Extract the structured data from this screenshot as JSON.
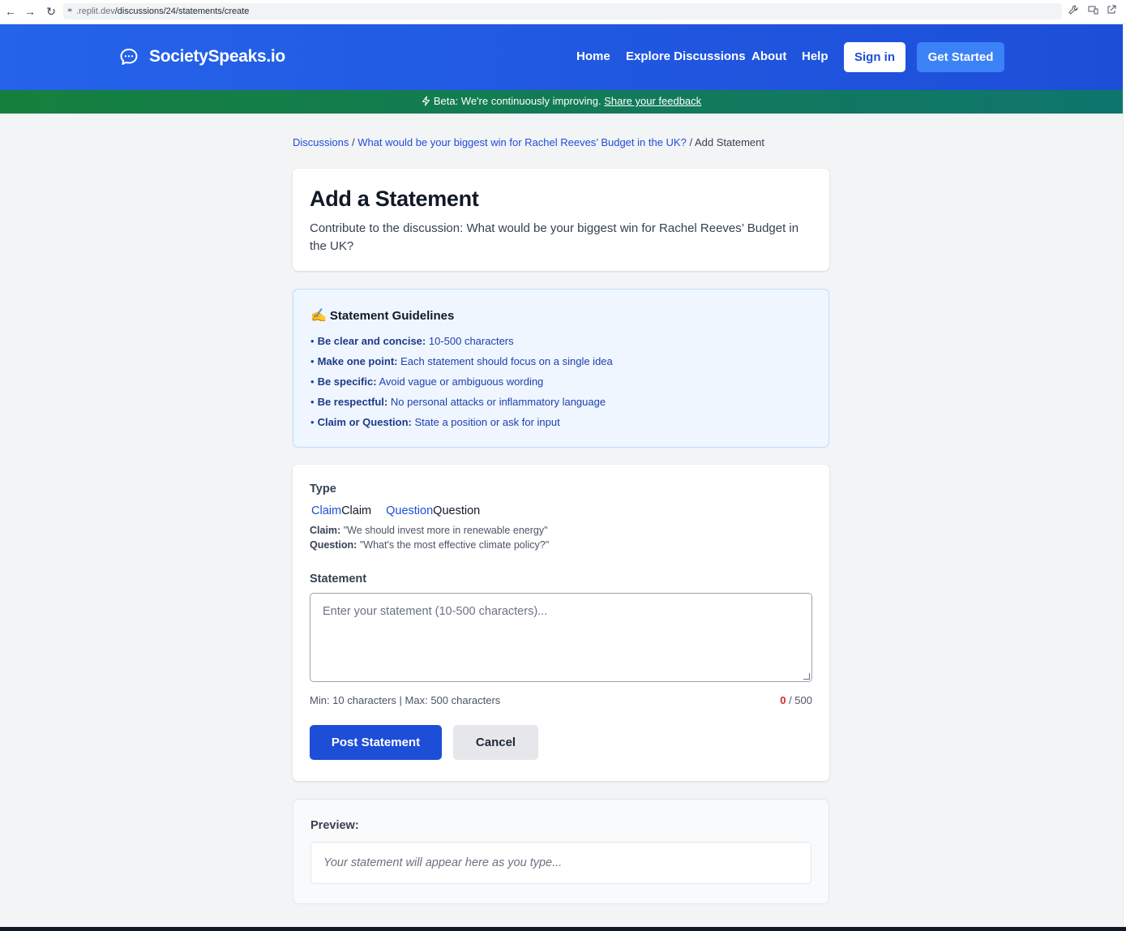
{
  "browser": {
    "url_host": ".replit.dev",
    "url_path": "/discussions/24/statements/create",
    "back_icon": "←",
    "forward_icon": "→",
    "reload_icon": "↻"
  },
  "header": {
    "brand": "SocietySpeaks.io",
    "nav": {
      "home": "Home",
      "explore": "Explore Discussions",
      "about": "About",
      "help": "Help"
    },
    "sign_in": "Sign in",
    "get_started": "Get Started"
  },
  "beta_banner": {
    "text": "Beta: We're continuously improving.",
    "link": "Share your feedback"
  },
  "breadcrumb": {
    "discussions": "Discussions",
    "sep1": " / ",
    "discussion_title": "What would be your biggest win for Rachel Reeves’ Budget in the UK?",
    "sep2": " / ",
    "current": "Add Statement"
  },
  "title_card": {
    "heading": "Add a Statement",
    "subtitle": "Contribute to the discussion: What would be your biggest win for Rachel Reeves’ Budget in the UK?"
  },
  "guidelines": {
    "emoji": "✍️",
    "heading": "Statement Guidelines",
    "items": [
      {
        "bold": "Be clear and concise:",
        "text": "10-500 characters"
      },
      {
        "bold": "Make one point:",
        "text": "Each statement should focus on a single idea"
      },
      {
        "bold": "Be specific:",
        "text": "Avoid vague or ambiguous wording"
      },
      {
        "bold": "Be respectful:",
        "text": "No personal attacks or inflammatory language"
      },
      {
        "bold": "Claim or Question:",
        "text": "State a position or ask for input"
      }
    ]
  },
  "form": {
    "type_label": "Type",
    "options": [
      {
        "label": "Claim",
        "text": "Claim"
      },
      {
        "label": "Question",
        "text": "Question"
      }
    ],
    "help": [
      {
        "bold": "Claim:",
        "text": "\"We should invest more in renewable energy\""
      },
      {
        "bold": "Question:",
        "text": "\"What's the most effective climate policy?\""
      }
    ],
    "statement_label": "Statement",
    "statement_placeholder": "Enter your statement (10-500 characters)...",
    "limits_text": "Min: 10 characters | Max: 500 characters",
    "count_current": "0",
    "count_max": " / 500",
    "post_button": "Post Statement",
    "cancel_button": "Cancel"
  },
  "preview": {
    "label": "Preview:",
    "placeholder": "Your statement will appear here as you type..."
  },
  "colors": {
    "primary": "#1d4ed8",
    "header_start": "#2563eb",
    "beta_green": "#15803d",
    "counter_red": "#dc2626"
  }
}
